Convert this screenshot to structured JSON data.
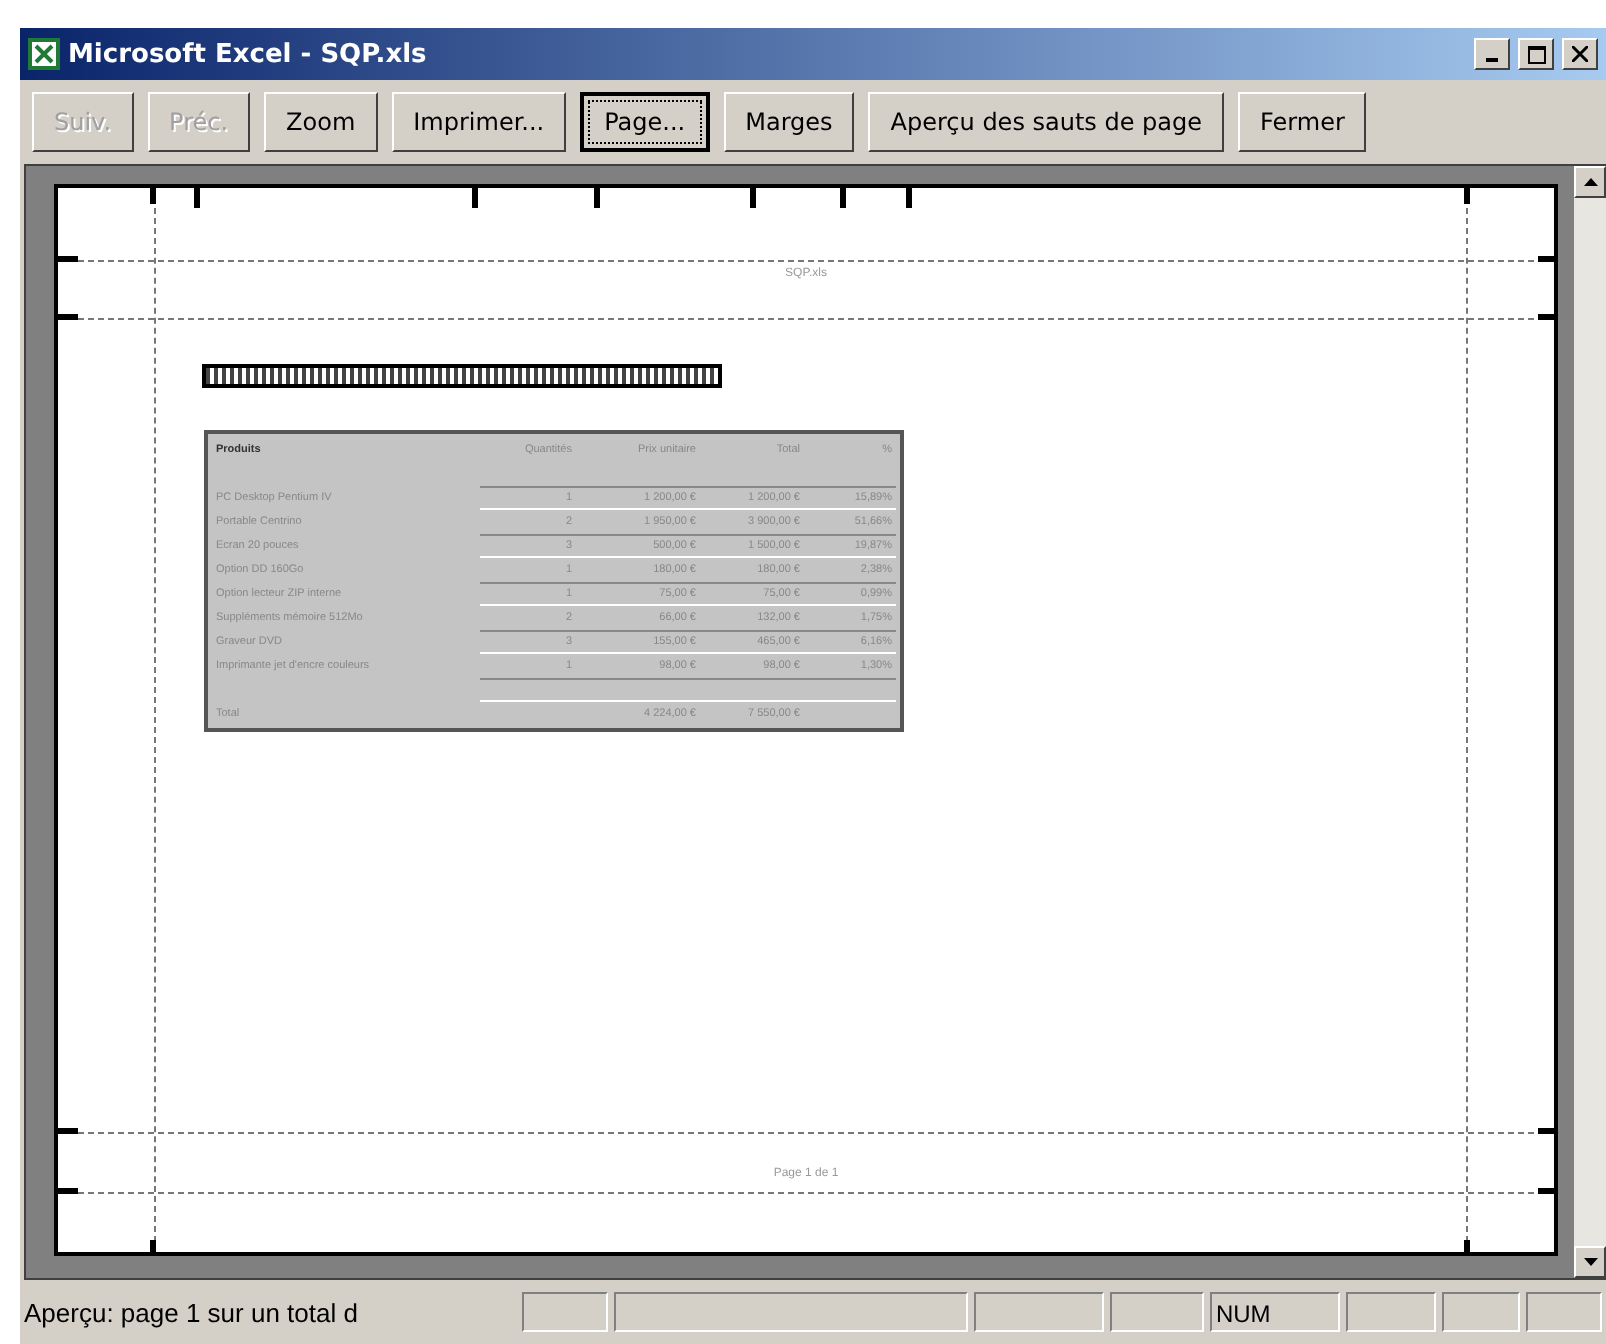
{
  "window": {
    "title": "Microsoft Excel - SQP.xls"
  },
  "buttons": [
    {
      "label": "Suiv.",
      "disabled": true,
      "focused": false
    },
    {
      "label": "Préc.",
      "disabled": true,
      "focused": false
    },
    {
      "label": "Zoom",
      "disabled": false,
      "focused": false
    },
    {
      "label": "Imprimer...",
      "disabled": false,
      "focused": false
    },
    {
      "label": "Page...",
      "disabled": false,
      "focused": true
    },
    {
      "label": "Marges",
      "disabled": false,
      "focused": false
    },
    {
      "label": "Aperçu des sauts de page",
      "disabled": false,
      "focused": false
    },
    {
      "label": "Fermer",
      "disabled": false,
      "focused": false
    }
  ],
  "page": {
    "header": "SQP.xls",
    "footer": "Page 1 de 1",
    "table": {
      "columns": [
        "Produits",
        "Quantités",
        "Prix unitaire",
        "Total",
        "%"
      ],
      "rows": [
        [
          "PC Desktop Pentium IV",
          "1",
          "1 200,00 €",
          "1 200,00 €",
          "15,89%"
        ],
        [
          "Portable Centrino",
          "2",
          "1 950,00 €",
          "3 900,00 €",
          "51,66%"
        ],
        [
          "Ecran 20 pouces",
          "3",
          "500,00 €",
          "1 500,00 €",
          "19,87%"
        ],
        [
          "Option DD 160Go",
          "1",
          "180,00 €",
          "180,00 €",
          "2,38%"
        ],
        [
          "Option lecteur ZIP interne",
          "1",
          "75,00 €",
          "75,00 €",
          "0,99%"
        ],
        [
          "Suppléments mémoire 512Mo",
          "2",
          "66,00 €",
          "132,00 €",
          "1,75%"
        ],
        [
          "Graveur DVD",
          "3",
          "155,00 €",
          "465,00 €",
          "6,16%"
        ],
        [
          "Imprimante jet d'encre couleurs",
          "1",
          "98,00 €",
          "98,00 €",
          "1,30%"
        ]
      ],
      "total": {
        "label": "Total",
        "unit_price": "4 224,00 €",
        "total": "7 550,00 €"
      }
    }
  },
  "status_bar": {
    "message": "Aperçu: page 1 sur un total d",
    "indicator": "NUM"
  }
}
